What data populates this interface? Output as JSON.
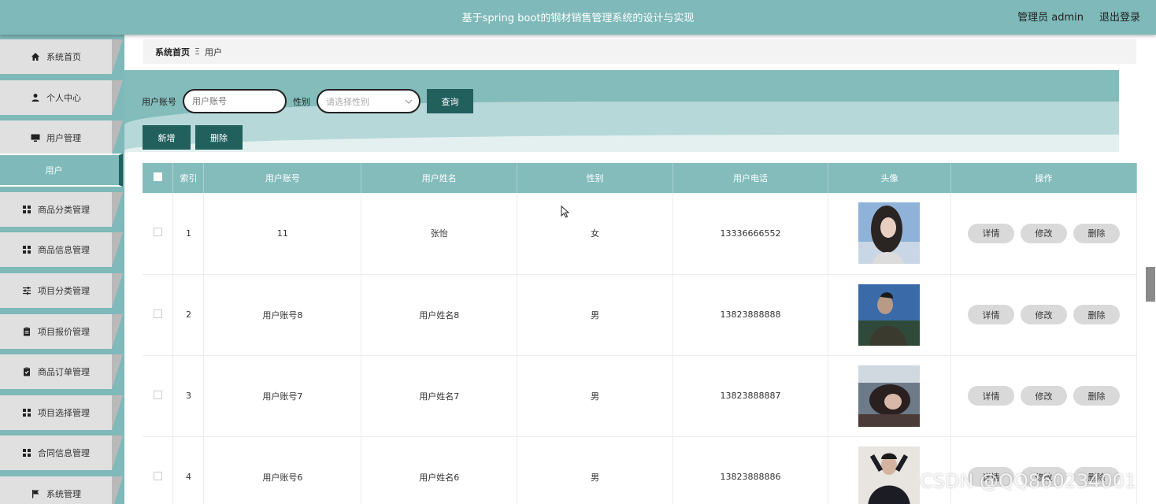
{
  "header": {
    "title": "基于spring boot的钢材销售管理系统的设计与实现",
    "user": "管理员 admin",
    "logout": "退出登录"
  },
  "sidebar": {
    "items": [
      {
        "label": "系统首页",
        "icon": "home-icon"
      },
      {
        "label": "个人中心",
        "icon": "person-icon"
      },
      {
        "label": "用户管理",
        "icon": "monitor-icon"
      },
      {
        "label": "商品分类管理",
        "icon": "grid-icon"
      },
      {
        "label": "商品信息管理",
        "icon": "grid-icon"
      },
      {
        "label": "项目分类管理",
        "icon": "sliders-icon"
      },
      {
        "label": "项目报价管理",
        "icon": "clipboard-icon"
      },
      {
        "label": "商品订单管理",
        "icon": "clipboard-check-icon"
      },
      {
        "label": "项目选择管理",
        "icon": "grid-icon"
      },
      {
        "label": "合同信息管理",
        "icon": "grid-icon"
      },
      {
        "label": "系统管理",
        "icon": "flag-icon"
      }
    ],
    "submenu_active": "用户"
  },
  "breadcrumb": {
    "home": "系统首页",
    "separator": "Ξ",
    "current": "用户"
  },
  "search": {
    "account_label": "用户账号",
    "account_placeholder": "用户账号",
    "gender_label": "性别",
    "gender_placeholder": "请选择性别",
    "query_button": "查询",
    "add_button": "新增",
    "delete_button": "删除"
  },
  "table": {
    "columns": [
      "索引",
      "用户账号",
      "用户姓名",
      "性别",
      "用户电话",
      "头像",
      "操作"
    ],
    "rows": [
      {
        "index": "1",
        "account": "11",
        "name": "张怡",
        "gender": "女",
        "phone": "13336666552"
      },
      {
        "index": "2",
        "account": "用户账号8",
        "name": "用户姓名8",
        "gender": "男",
        "phone": "13823888888"
      },
      {
        "index": "3",
        "account": "用户账号7",
        "name": "用户姓名7",
        "gender": "男",
        "phone": "13823888887"
      },
      {
        "index": "4",
        "account": "用户账号6",
        "name": "用户姓名6",
        "gender": "男",
        "phone": "13823888886"
      }
    ],
    "actions": {
      "detail": "详情",
      "edit": "修改",
      "delete": "删除"
    }
  },
  "watermark": "CSDN @QQ860234001",
  "colors": {
    "accent": "#7fb9b9",
    "dark": "#22605e",
    "table_header": "#84bcbc"
  }
}
